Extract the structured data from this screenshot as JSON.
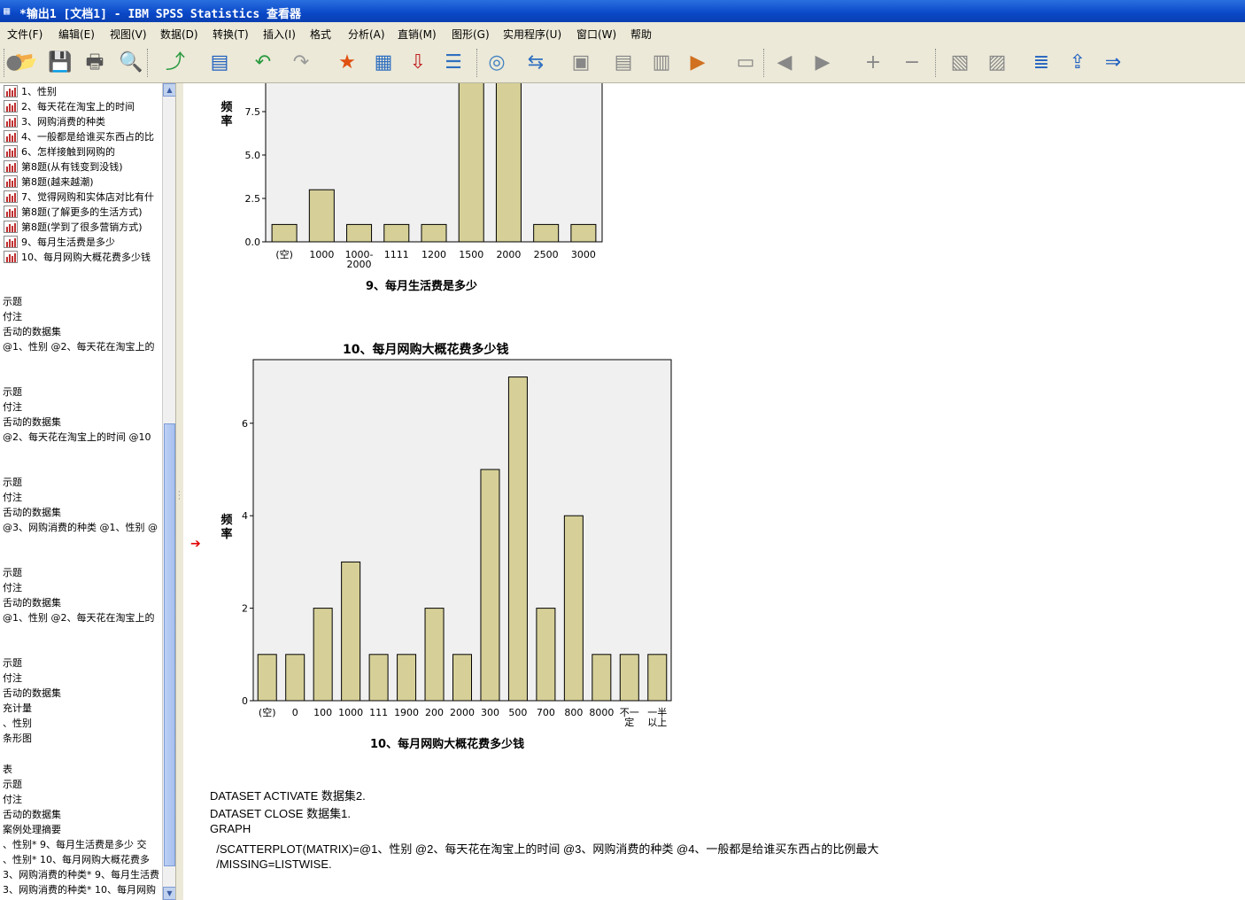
{
  "window": {
    "title": "*输出1 [文档1] - IBM SPSS Statistics 查看器"
  },
  "menu": [
    "文件(F)",
    "编辑(E)",
    "视图(V)",
    "数据(D)",
    "转换(T)",
    "插入(I)",
    "格式",
    "分析(A)",
    "直销(M)",
    "图形(G)",
    "实用程序(U)",
    "窗口(W)",
    "帮助"
  ],
  "toolbar": {
    "icons": [
      "open-icon",
      "save-icon",
      "print-icon",
      "print-preview-icon",
      "export-icon",
      "recall-dialog-icon",
      "undo-icon",
      "redo-icon",
      "goto-data-icon",
      "goto-case-icon",
      "goto-variable-icon",
      "variables-icon",
      "designate-window-icon",
      "spacer",
      "select-cases-icon",
      "value-labels-icon",
      "run-script-icon",
      "promote-icon",
      "demote-icon",
      "create-report-icon",
      "display-icon",
      "back-icon",
      "forward-icon",
      "expand-icon",
      "collapse-icon",
      "show-icon",
      "hide-icon",
      "insert-heading-icon",
      "insert-title-icon",
      "insert-text-icon"
    ]
  },
  "outline": {
    "chart_items": [
      "1、性别",
      "2、每天花在淘宝上的时间",
      "3、网购消费的种类",
      "4、一般都是给谁买东西占的比",
      "6、怎样接触到网购的",
      "第8题(从有钱变到没钱)",
      "第8题(越来越潮)",
      "7、觉得网购和实体店对比有什",
      "第8题(了解更多的生活方式)",
      "第8题(学到了很多营销方式)",
      "9、每月生活费是多少",
      "10、每月网购大概花费多少钱"
    ],
    "groups": [
      [
        "示题",
        "付注",
        "舌动的数据集",
        "@1、性别 @2、每天花在淘宝上的"
      ],
      [
        "示题",
        "付注",
        "舌动的数据集",
        "@2、每天花在淘宝上的时间 @10"
      ],
      [
        "示题",
        "付注",
        "舌动的数据集",
        "@3、网购消费的种类 @1、性别 @"
      ],
      [
        "示题",
        "付注",
        "舌动的数据集",
        "@1、性别 @2、每天花在淘宝上的"
      ],
      [
        "示题",
        "付注",
        "舌动的数据集",
        "充计量",
        "、性别",
        "条形图"
      ],
      [
        "表",
        "示题",
        "付注",
        "舌动的数据集",
        "案例处理摘要",
        "、性别* 9、每月生活费是多少 交",
        "、性别* 10、每月网购大概花费多",
        "3、网购消费的种类* 9、每月生活费",
        "3、网购消费的种类* 10、每月网购"
      ]
    ]
  },
  "chart1": {
    "ylabel": "频率",
    "xlabel": "9、每月生活费是多少",
    "yticks": [
      "0.0",
      "2.5",
      "5.0",
      "7.5"
    ]
  },
  "chart2": {
    "title": "10、每月网购大概花费多少钱",
    "ylabel": "频率",
    "xlabel": "10、每月网购大概花费多少钱",
    "yticks": [
      "0",
      "2",
      "4",
      "6"
    ]
  },
  "chart_data": [
    {
      "type": "bar",
      "title": "",
      "xlabel": "9、每月生活费是多少",
      "ylabel": "频率",
      "categories": [
        "(空)",
        "1000",
        "1000-\n2000",
        "1111",
        "1200",
        "1500",
        "2000",
        "2500",
        "3000"
      ],
      "values": [
        1,
        3,
        1,
        1,
        1,
        12,
        12,
        1,
        1
      ],
      "ylim": [
        0,
        10
      ],
      "yticks": [
        0,
        2.5,
        5.0,
        7.5
      ],
      "grid": false
    },
    {
      "type": "bar",
      "title": "10、每月网购大概花费多少钱",
      "xlabel": "10、每月网购大概花费多少钱",
      "ylabel": "频率",
      "categories": [
        "(空)",
        "0",
        "100",
        "1000",
        "111",
        "1900",
        "200",
        "2000",
        "300",
        "500",
        "700",
        "800",
        "8000",
        "不一\n定",
        "一半\n以上"
      ],
      "values": [
        1,
        1,
        2,
        3,
        1,
        1,
        2,
        1,
        5,
        7,
        2,
        4,
        1,
        1,
        1
      ],
      "ylim": [
        0,
        7.3
      ],
      "yticks": [
        0,
        2,
        4,
        6
      ],
      "grid": false
    }
  ],
  "syntax": [
    "DATASET ACTIVATE 数据集2.",
    "DATASET CLOSE 数据集1.",
    "GRAPH",
    "  /SCATTERPLOT(MATRIX)=@1、性别 @2、每天花在淘宝上的时间 @3、网购消费的种类 @4、一般都是给谁买东西占的比例最大",
    "  /MISSING=LISTWISE."
  ],
  "colors": {
    "bar_fill": "#d6d098",
    "plot_bg": "#f0f0f0",
    "title_bar": "#0a48c8",
    "marker": "#e00000"
  }
}
